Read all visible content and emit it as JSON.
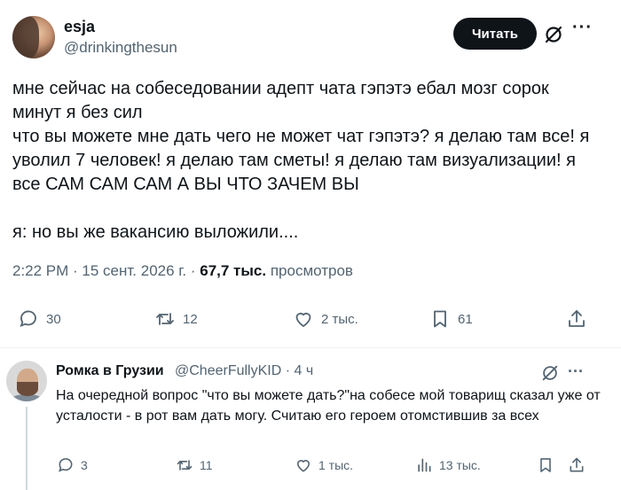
{
  "tweet": {
    "name": "esja",
    "handle": "@drinkingthesun",
    "follow_label": "Читать",
    "text": "мне сейчас на собеседовании адепт чата гэпэтэ ебал мозг сорок минут я без сил\nчто вы можете мне дать чего не может чат гэпэтэ? я делаю там все! я уволил 7 человек! я делаю там сметы! я делаю там визуализации! я все САМ САМ САМ А ВЫ ЧТО ЗАЧЕМ ВЫ\n\nя: но вы же вакансию выложили....",
    "time": "2:22 PM",
    "date": "15 сент. 2026 г.",
    "views": "67,7 тыс.",
    "views_label": "просмотров",
    "replies": "30",
    "retweets": "12",
    "likes": "2 тыс.",
    "bookmarks": "61"
  },
  "reply": {
    "name": "Ромка в Грузии",
    "handle": "@CheerFullyKID · 4 ч",
    "text": "На очередной вопрос \"что вы можете дать?\"на собесе мой товарищ сказал уже от усталости - в рот вам дать могу. Считаю его героем отомстившив за всех",
    "replies": "3",
    "retweets": "11",
    "likes": "1 тыс.",
    "views": "13 тыс."
  },
  "icons": [
    "grok-icon",
    "more-icon",
    "reply-icon",
    "retweet-icon",
    "like-icon",
    "bookmark-icon",
    "share-icon",
    "views-icon"
  ]
}
